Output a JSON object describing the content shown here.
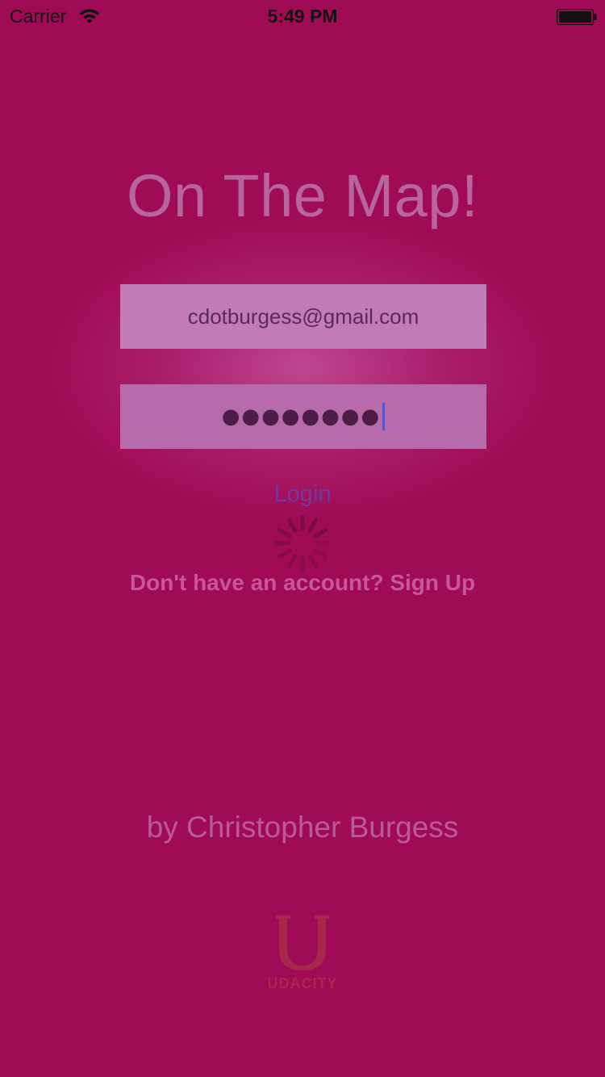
{
  "status_bar": {
    "carrier": "Carrier",
    "time": "5:49 PM",
    "wifi_icon": "wifi-icon",
    "battery_icon": "battery-icon"
  },
  "title": "On The Map!",
  "login_form": {
    "email_value": "cdotburgess@gmail.com",
    "password_masked": "●●●●●●●●",
    "login_label": "Login",
    "loading": true
  },
  "signup": {
    "label": "Don't have an account? Sign Up"
  },
  "credit": "by Christopher Burgess",
  "logo": {
    "text": "UDACITY",
    "icon": "udacity-logo-icon"
  },
  "colors": {
    "background": "#a00b55",
    "field_email": "#c17cb6",
    "field_password": "#b76aac",
    "login_text": "#6e3a9e",
    "caret": "#5a53c9",
    "logo": "#a8274d"
  }
}
